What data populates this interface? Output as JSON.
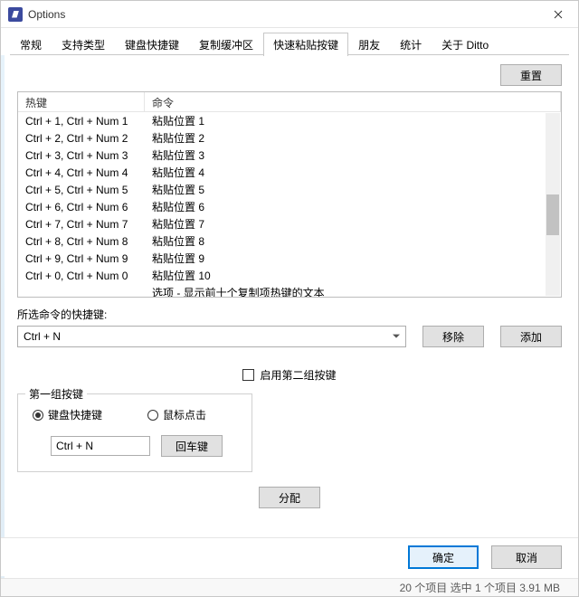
{
  "window": {
    "title": "Options"
  },
  "tabs": [
    "常规",
    "支持类型",
    "键盘快捷键",
    "复制缓冲区",
    "快速粘贴按键",
    "朋友",
    "统计",
    "关于 Ditto"
  ],
  "active_tab": 4,
  "reset_label": "重置",
  "listview": {
    "headers": {
      "hotkey": "热键",
      "command": "命令"
    },
    "rows": [
      {
        "hk": "Ctrl + 1, Ctrl + Num 1",
        "cmd": "粘贴位置 1"
      },
      {
        "hk": "Ctrl + 2, Ctrl + Num 2",
        "cmd": "粘贴位置 2"
      },
      {
        "hk": "Ctrl + 3, Ctrl + Num 3",
        "cmd": "粘贴位置 3"
      },
      {
        "hk": "Ctrl + 4, Ctrl + Num 4",
        "cmd": "粘贴位置 4"
      },
      {
        "hk": "Ctrl + 5, Ctrl + Num 5",
        "cmd": "粘贴位置 5"
      },
      {
        "hk": "Ctrl + 6, Ctrl + Num 6",
        "cmd": "粘贴位置 6"
      },
      {
        "hk": "Ctrl + 7, Ctrl + Num 7",
        "cmd": "粘贴位置 7"
      },
      {
        "hk": "Ctrl + 8, Ctrl + Num 8",
        "cmd": "粘贴位置 8"
      },
      {
        "hk": "Ctrl + 9, Ctrl + Num 9",
        "cmd": "粘贴位置 9"
      },
      {
        "hk": "Ctrl + 0, Ctrl + Num 0",
        "cmd": "粘贴位置 10"
      },
      {
        "hk": "",
        "cmd": "选项 - 显示前十个复制项热键的文本"
      }
    ]
  },
  "selected_label": "所选命令的快捷键:",
  "combo_value": "Ctrl + N",
  "remove_label": "移除",
  "add_label": "添加",
  "enable_group2_label": "启用第二组按键",
  "fieldset": {
    "legend": "第一组按键",
    "radio_keyboard": "键盘快捷键",
    "radio_mouse": "鼠标点击",
    "key_value": "Ctrl + N",
    "enter_label": "回车键"
  },
  "assign_label": "分配",
  "ok_label": "确定",
  "cancel_label": "取消",
  "status": "20 个项目    选中 1 个项目   3.91 MB"
}
